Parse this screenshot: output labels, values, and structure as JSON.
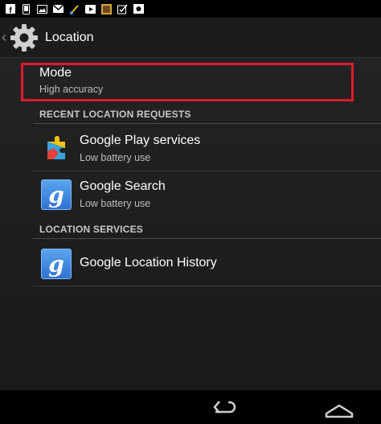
{
  "status_icons": [
    "facebook-icon",
    "phone-icon",
    "image-icon",
    "gmail-icon",
    "paintbrush-icon",
    "youtube-icon",
    "gallery-icon",
    "checklist-icon",
    "photo-icon"
  ],
  "action_bar": {
    "title": "Location"
  },
  "mode": {
    "title": "Mode",
    "value": "High accuracy",
    "highlight_color": "#e21a2b"
  },
  "recent_requests": {
    "header": "RECENT LOCATION REQUESTS",
    "items": [
      {
        "title": "Google Play services",
        "subtitle": "Low battery use",
        "icon": "google-play-services-icon"
      },
      {
        "title": "Google Search",
        "subtitle": "Low battery use",
        "icon": "google-search-icon"
      }
    ]
  },
  "location_services": {
    "header": "LOCATION SERVICES",
    "items": [
      {
        "title": "Google Location History",
        "icon": "google-location-history-icon"
      }
    ]
  },
  "nav": [
    "back-icon",
    "home-icon"
  ]
}
